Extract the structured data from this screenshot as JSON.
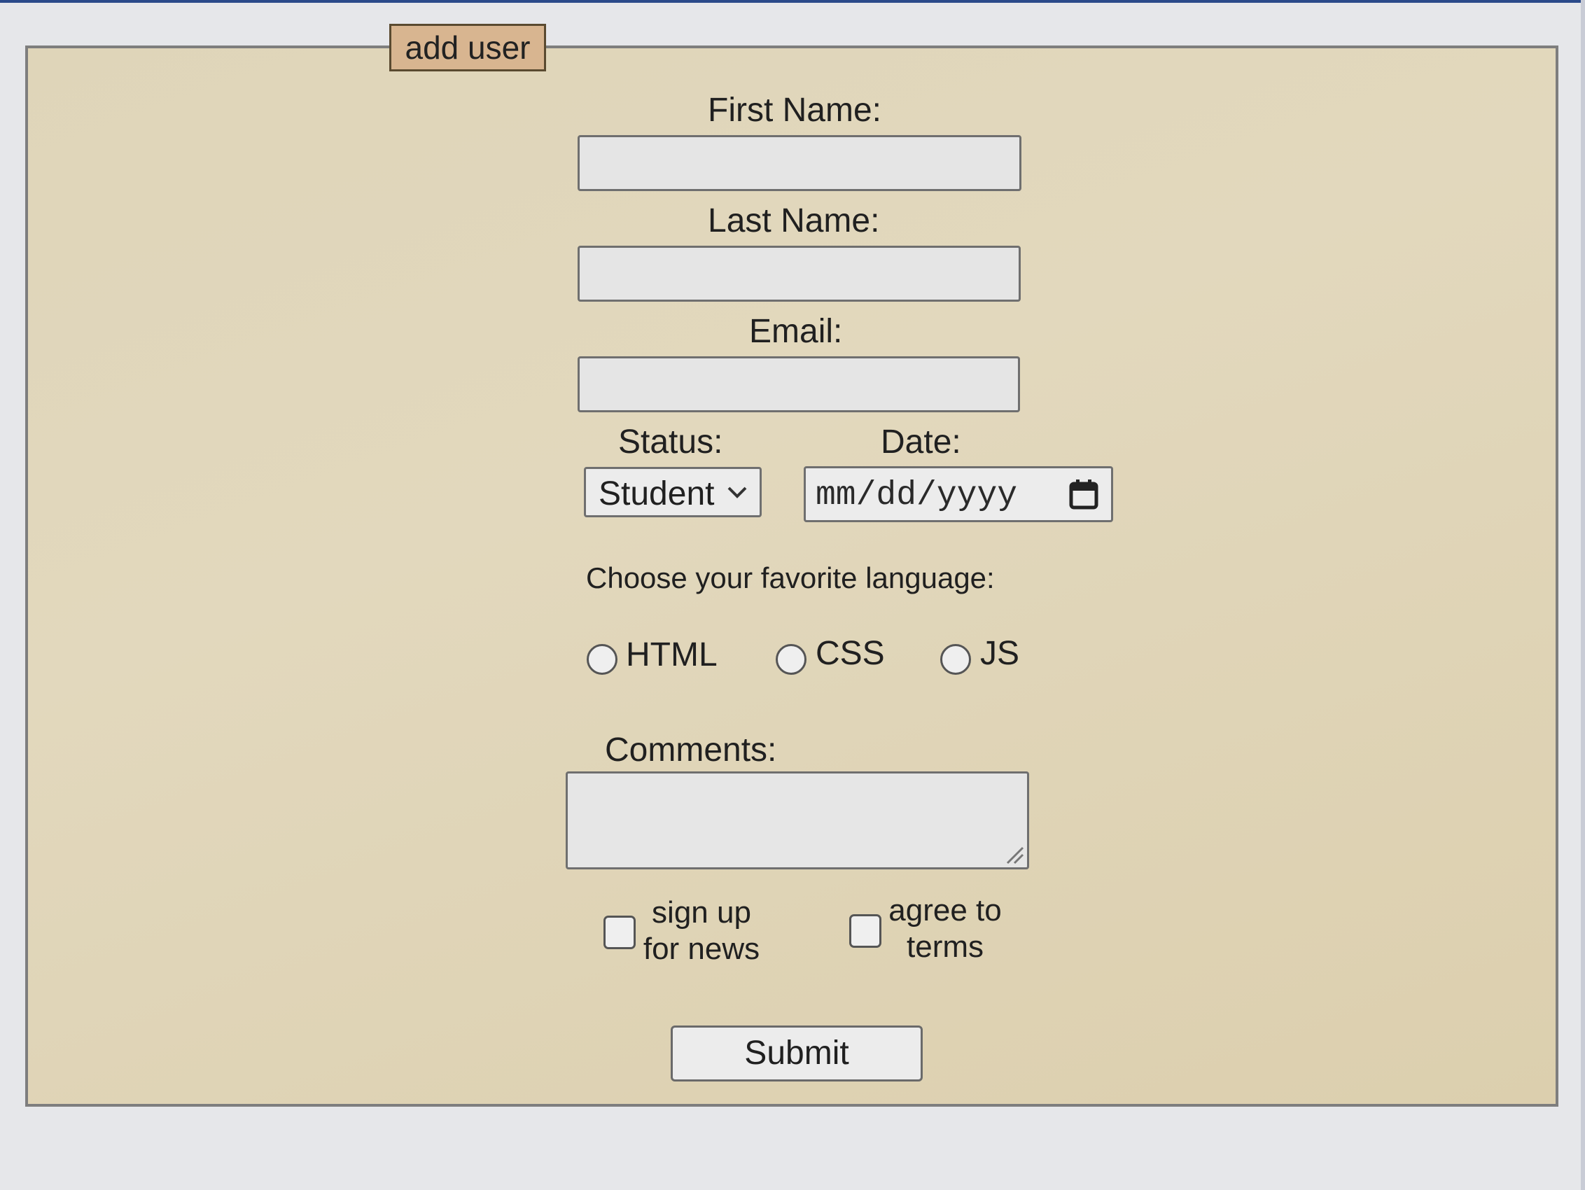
{
  "form": {
    "legend": "add user",
    "first_name_label": "First Name:",
    "last_name_label": "Last Name:",
    "email_label": "Email:",
    "first_name_value": "",
    "last_name_value": "",
    "email_value": "",
    "status_label": "Status:",
    "status_selected": "Student",
    "date_label": "Date:",
    "date_placeholder": "mm/dd/yyyy",
    "language_prompt": "Choose your favorite language:",
    "language_options": [
      "HTML",
      "CSS",
      "JS"
    ],
    "comments_label": "Comments:",
    "comments_value": "",
    "signup_label_line1": "sign up",
    "signup_label_line2": "for news",
    "terms_label_line1": "agree to",
    "terms_label_line2": "terms",
    "submit_label": "Submit"
  },
  "icons": {
    "status_dropdown": "chevron-down-icon",
    "date_picker": "calendar-icon",
    "textarea_resize": "resize-grip-icon"
  },
  "colors": {
    "panel_background": "#e0d6ba",
    "legend_background": "#d8b590",
    "input_background": "#e5e5e5"
  }
}
